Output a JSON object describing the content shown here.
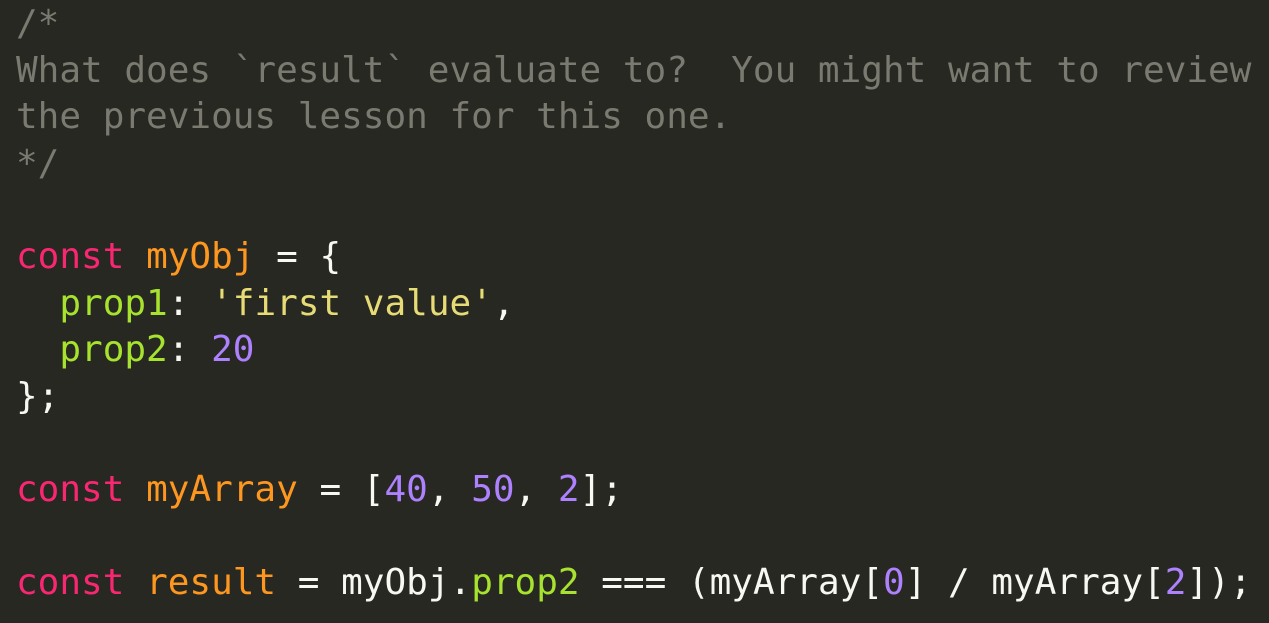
{
  "colors": {
    "background": "#272822",
    "comment": "#7a7a70",
    "keyword": "#f92672",
    "variable": "#fd971f",
    "property": "#a6e22e",
    "string": "#e6db74",
    "number": "#ae81ff",
    "default": "#f8f8f2"
  },
  "lines": [
    [
      {
        "t": "/*",
        "c": "comment"
      }
    ],
    [
      {
        "t": "What does `result` evaluate to?  You might want to review",
        "c": "comment"
      }
    ],
    [
      {
        "t": "the previous lesson for this one.",
        "c": "comment"
      }
    ],
    [
      {
        "t": "*/",
        "c": "comment"
      }
    ],
    [],
    [
      {
        "t": "const",
        "c": "keyword"
      },
      {
        "t": " ",
        "c": "default"
      },
      {
        "t": "myObj",
        "c": "variable"
      },
      {
        "t": " = {",
        "c": "default"
      }
    ],
    [
      {
        "t": "  ",
        "c": "default"
      },
      {
        "t": "prop1",
        "c": "property"
      },
      {
        "t": ": ",
        "c": "default"
      },
      {
        "t": "'first value'",
        "c": "string"
      },
      {
        "t": ",",
        "c": "default"
      }
    ],
    [
      {
        "t": "  ",
        "c": "default"
      },
      {
        "t": "prop2",
        "c": "property"
      },
      {
        "t": ": ",
        "c": "default"
      },
      {
        "t": "20",
        "c": "number"
      }
    ],
    [
      {
        "t": "};",
        "c": "default"
      }
    ],
    [],
    [
      {
        "t": "const",
        "c": "keyword"
      },
      {
        "t": " ",
        "c": "default"
      },
      {
        "t": "myArray",
        "c": "variable"
      },
      {
        "t": " = [",
        "c": "default"
      },
      {
        "t": "40",
        "c": "number"
      },
      {
        "t": ", ",
        "c": "default"
      },
      {
        "t": "50",
        "c": "number"
      },
      {
        "t": ", ",
        "c": "default"
      },
      {
        "t": "2",
        "c": "number"
      },
      {
        "t": "];",
        "c": "default"
      }
    ],
    [],
    [
      {
        "t": "const",
        "c": "keyword"
      },
      {
        "t": " ",
        "c": "default"
      },
      {
        "t": "result",
        "c": "variable"
      },
      {
        "t": " = myObj.",
        "c": "default"
      },
      {
        "t": "prop2",
        "c": "property"
      },
      {
        "t": " === (myArray[",
        "c": "default"
      },
      {
        "t": "0",
        "c": "number"
      },
      {
        "t": "] / myArray[",
        "c": "default"
      },
      {
        "t": "2",
        "c": "number"
      },
      {
        "t": "]);",
        "c": "default"
      }
    ]
  ]
}
